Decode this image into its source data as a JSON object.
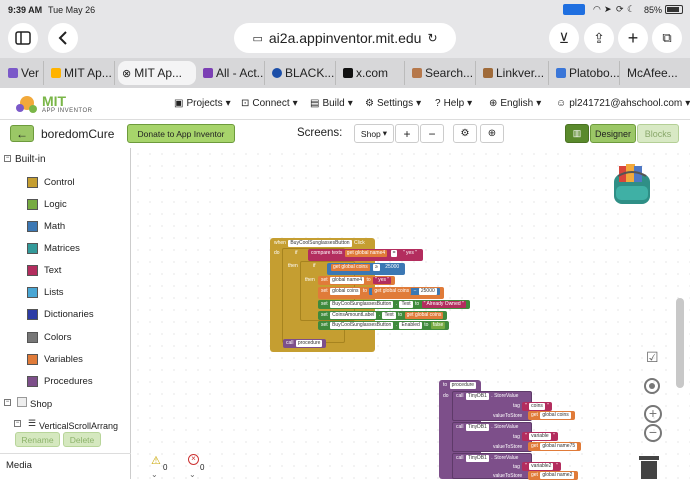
{
  "status": {
    "time": "9:39 AM",
    "date": "Tue May 26",
    "battery": "85%"
  },
  "browser": {
    "url": "ai2a.appinventor.mit.edu",
    "tabs": [
      {
        "label": "Ver",
        "color": "#7b59c9"
      },
      {
        "label": "MIT Ap...",
        "color": "#ffb300"
      },
      {
        "label": "MIT Ap...",
        "color": "#333"
      },
      {
        "label": "All - Act...",
        "color": "#7b3fb4"
      },
      {
        "label": "BLACK...",
        "color": "#1b4ea8"
      },
      {
        "label": "x.com",
        "color": "#111"
      },
      {
        "label": "Search...",
        "color": "#b6784b"
      },
      {
        "label": "Linkver...",
        "color": "#a06b3a"
      },
      {
        "label": "Platobo...",
        "color": "#3a76d8"
      },
      {
        "label": "McAfee...",
        "color": "#c22"
      }
    ]
  },
  "ai": {
    "brand": "MIT",
    "brand_sub": "APP INVENTOR",
    "menus": [
      {
        "label": "Projects"
      },
      {
        "label": "Connect"
      },
      {
        "label": "Build"
      },
      {
        "label": "Settings"
      },
      {
        "label": "Help"
      },
      {
        "label": "English"
      },
      {
        "label": "pl241721@ahschool.com"
      }
    ]
  },
  "toolbar": {
    "project": "boredomCure",
    "donate": "Donate to App Inventor",
    "screens_label": "Screens:",
    "screen": "Shop",
    "add": "+",
    "remove": "−",
    "designer": "Designer",
    "blocks": "Blocks"
  },
  "sidebar": {
    "builtin": "Built-in",
    "categories": [
      {
        "label": "Control",
        "color": "#c59e31"
      },
      {
        "label": "Logic",
        "color": "#77ab41"
      },
      {
        "label": "Math",
        "color": "#3c78b4"
      },
      {
        "label": "Matrices",
        "color": "#339a9a"
      },
      {
        "label": "Text",
        "color": "#b32d5e"
      },
      {
        "label": "Lists",
        "color": "#49a6d4"
      },
      {
        "label": "Dictionaries",
        "color": "#2d3ca5"
      },
      {
        "label": "Colors",
        "color": "#777777"
      },
      {
        "label": "Variables",
        "color": "#e07b39"
      },
      {
        "label": "Procedures",
        "color": "#7d4f8a"
      }
    ],
    "shop": "Shop",
    "vsa": "VerticalScrollArrang",
    "rename": "Rename",
    "delete": "Delete",
    "media": "Media"
  },
  "blocks": {
    "when": "when",
    "button": "BuyCoolSunglassesButton",
    "click": "Click",
    "do": "do",
    "if": "if",
    "then": "then",
    "compare": "compare texts",
    "get": "get",
    "name4": "global name4",
    "op_eq": "=",
    "yes": "yes",
    "coins": "global coins",
    "ge": "≥",
    "n25000": "25000",
    "set": "set",
    "to": "to",
    "minus": "−",
    "text": "Text",
    "already_owned": "Already Owned",
    "amount_label": "CoinsAmountLabel",
    "enabled": "Enabled",
    "false": "false",
    "call": "call",
    "procedure": "procedure",
    "to_proc": "to",
    "tinydb": "TinyDB1",
    "store": "StoreValue",
    "tag": "tag",
    "valueToStore": "valueToStore",
    "t_coins": "coins",
    "t_variable": "variable",
    "t_variable2": "variable2",
    "name75": "global name75",
    "name2": "global name2"
  },
  "counts": {
    "warnings": "0",
    "errors": "0"
  }
}
